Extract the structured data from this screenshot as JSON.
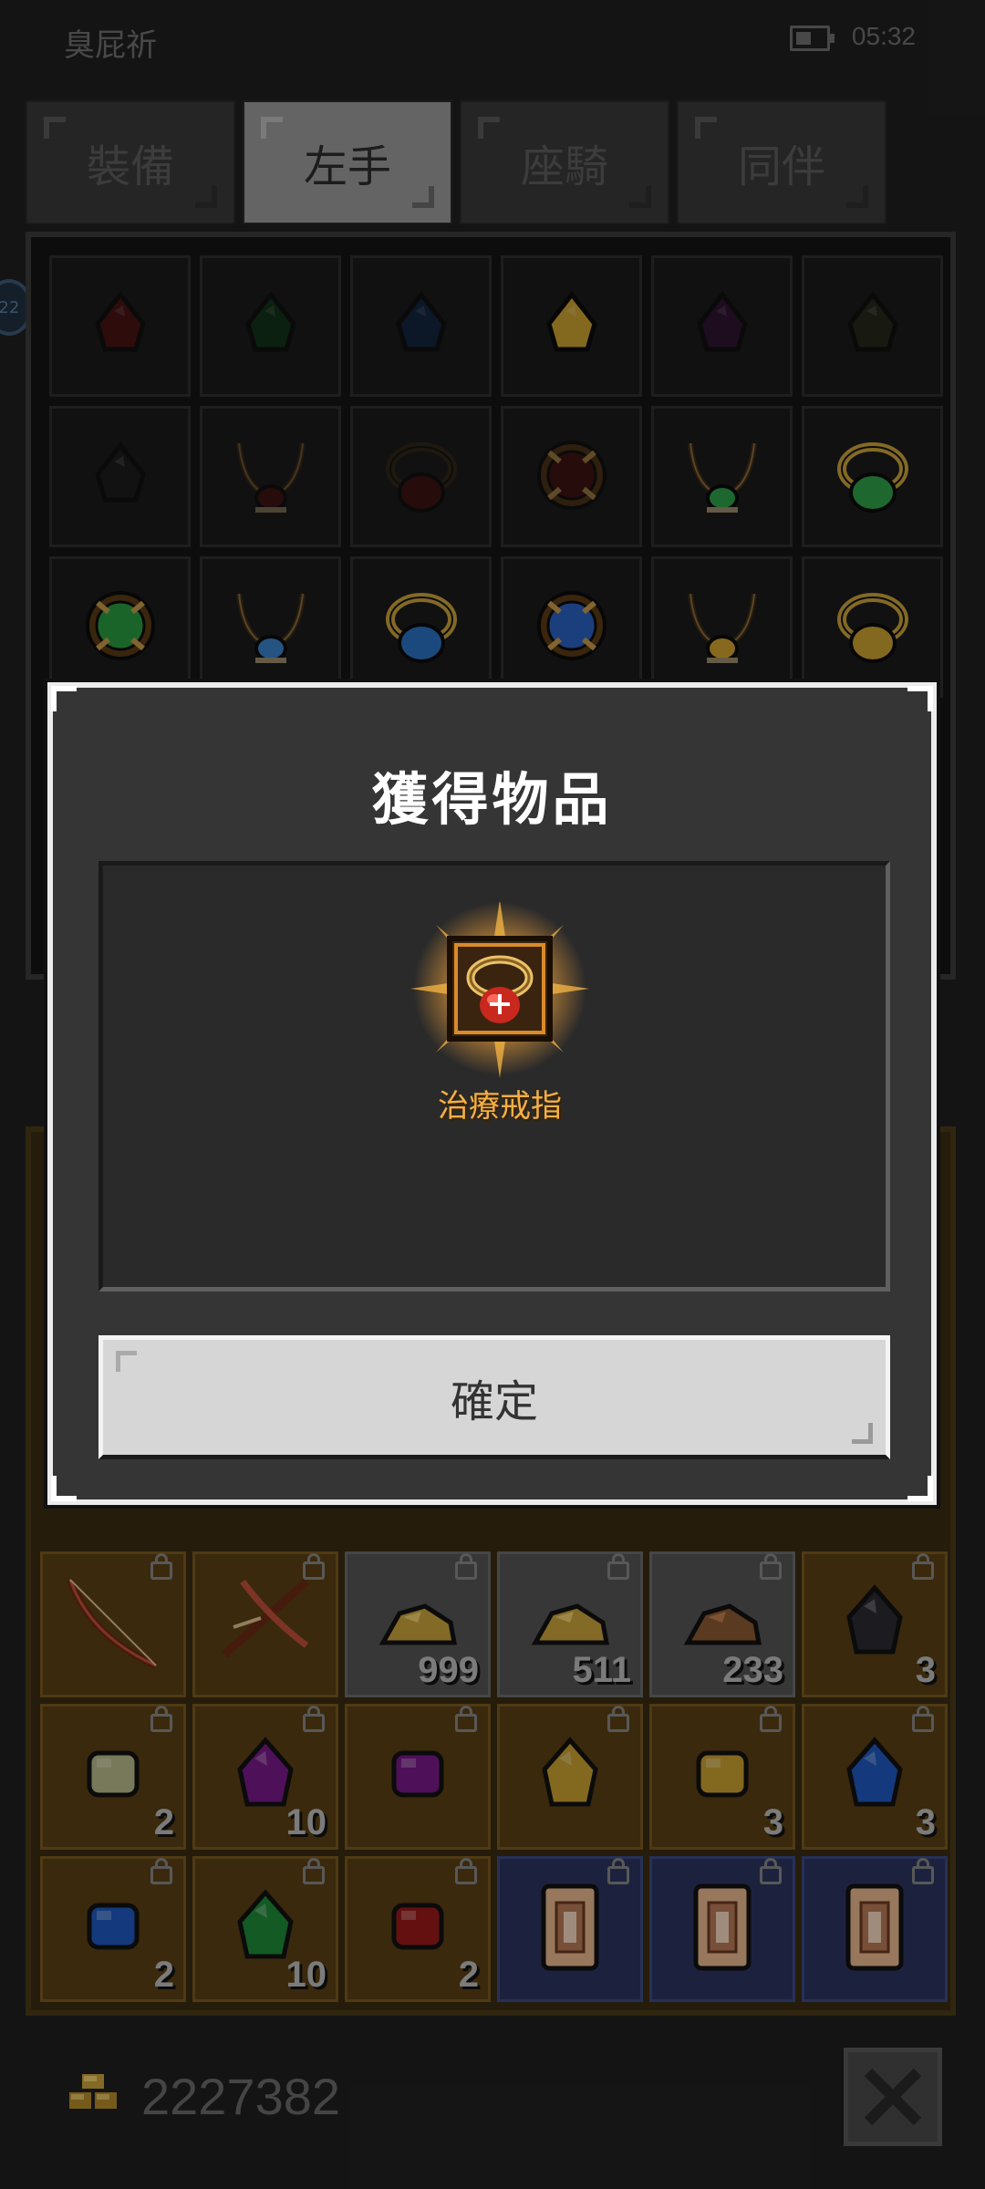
{
  "status": {
    "title": "臭屁祈",
    "time": "05:32"
  },
  "tabs": [
    {
      "label": "裝備",
      "active": false
    },
    {
      "label": "左手",
      "active": true
    },
    {
      "label": "座騎",
      "active": false
    },
    {
      "label": "同伴",
      "active": false
    }
  ],
  "inventory": {
    "rows": [
      [
        "red-gem-icon",
        "green-gem-icon",
        "blue-gem-icon",
        "yellow-gem-icon",
        "purple-gem-icon",
        "pale-gem-icon"
      ],
      [
        "black-gem-icon",
        "ruby-necklace-icon",
        "ruby-ring-icon",
        "ruby-amulet-icon",
        "emerald-necklace-icon",
        "emerald-ring-icon"
      ],
      [
        "emerald-amulet-icon",
        "sapphire-necklace-icon",
        "sapphire-ring-icon",
        "sapphire-amulet-icon",
        "topaz-necklace-icon",
        "topaz-ring-icon"
      ]
    ]
  },
  "materials": [
    {
      "icon": "bow-icon",
      "qty": "",
      "type": "orange"
    },
    {
      "icon": "crossbow-icon",
      "qty": "",
      "type": "orange"
    },
    {
      "icon": "gold-ore-icon",
      "qty": "999",
      "type": "gray"
    },
    {
      "icon": "gold-ore-icon",
      "qty": "511",
      "type": "gray"
    },
    {
      "icon": "copper-ore-icon",
      "qty": "233",
      "type": "gray"
    },
    {
      "icon": "black-crystal-icon",
      "qty": "3",
      "type": "orange"
    },
    {
      "icon": "pale-stone-icon",
      "qty": "2",
      "type": "orange"
    },
    {
      "icon": "purple-crystal-icon",
      "qty": "10",
      "type": "orange"
    },
    {
      "icon": "purple-stone-icon",
      "qty": "",
      "type": "orange"
    },
    {
      "icon": "yellow-crystal-icon",
      "qty": "",
      "type": "orange"
    },
    {
      "icon": "yellow-stone-icon",
      "qty": "3",
      "type": "orange"
    },
    {
      "icon": "blue-crystal-icon",
      "qty": "3",
      "type": "orange"
    },
    {
      "icon": "blue-stone-icon",
      "qty": "2",
      "type": "orange"
    },
    {
      "icon": "green-crystal-icon",
      "qty": "10",
      "type": "orange"
    },
    {
      "icon": "red-stone-icon",
      "qty": "2",
      "type": "orange"
    },
    {
      "icon": "scroll-icon",
      "qty": "",
      "type": "blue"
    },
    {
      "icon": "scroll-icon",
      "qty": "",
      "type": "blue"
    },
    {
      "icon": "scroll-icon",
      "qty": "",
      "type": "blue"
    }
  ],
  "footer": {
    "gold": "2227382"
  },
  "dialog": {
    "title": "獲得物品",
    "item_name": "治療戒指",
    "item_icon": "healing-ring-icon",
    "confirm_label": "確定"
  },
  "colors": {
    "reward_text": "#f3b046",
    "glow": "#f2a23a",
    "dialog_bg": "#353535"
  }
}
